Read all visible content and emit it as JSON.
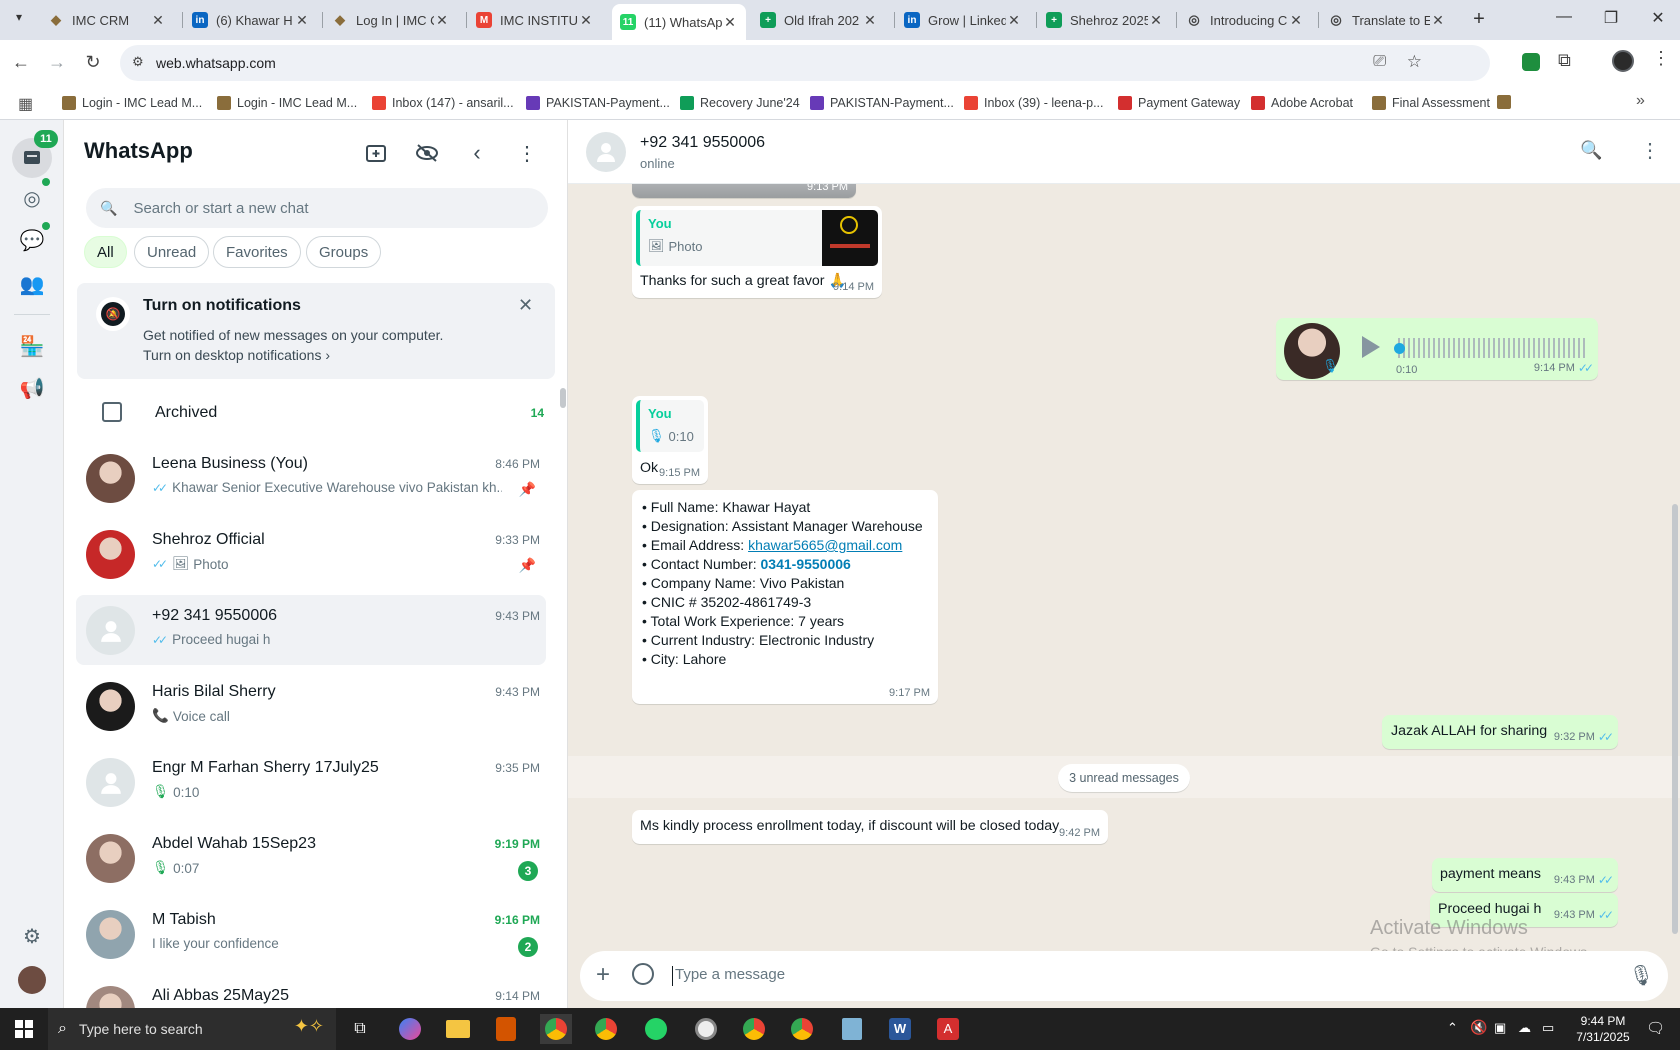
{
  "browser": {
    "tabs": [
      {
        "title": "IMC CRM",
        "color": "#8a6d3b",
        "glyph": "◆"
      },
      {
        "title": "(6) Khawar H",
        "color": "#0a66c2",
        "glyph": "in"
      },
      {
        "title": "Log In | IMC C",
        "color": "#8a6d3b",
        "glyph": "◆"
      },
      {
        "title": "IMC INSTITUT",
        "color": "#ea4335",
        "glyph": "M"
      },
      {
        "title": "(11) WhatsApp",
        "color": "#25d366",
        "glyph": "11",
        "active": true
      },
      {
        "title": "Old Ifrah 202",
        "color": "#0f9d58",
        "glyph": "+"
      },
      {
        "title": "Grow | Linked",
        "color": "#0a66c2",
        "glyph": "in"
      },
      {
        "title": "Shehroz 2025",
        "color": "#0f9d58",
        "glyph": "+"
      },
      {
        "title": "Introducing C",
        "color": "#444444",
        "glyph": "◎"
      },
      {
        "title": "Translate to E",
        "color": "#444444",
        "glyph": "◎"
      }
    ],
    "url": "web.whatsapp.com",
    "bookmarks": [
      {
        "label": "Login - IMC Lead M...",
        "color": "#8a6d3b"
      },
      {
        "label": "Login - IMC Lead M...",
        "color": "#8a6d3b"
      },
      {
        "label": "Inbox (147) - ansaril...",
        "color": "#ea4335"
      },
      {
        "label": "PAKISTAN-Payment...",
        "color": "#673ab7"
      },
      {
        "label": "Recovery June'24",
        "color": "#0f9d58"
      },
      {
        "label": "PAKISTAN-Payment...",
        "color": "#673ab7"
      },
      {
        "label": "Inbox (39) - leena-p...",
        "color": "#ea4335"
      },
      {
        "label": "Payment Gateway",
        "color": "#d32f2f"
      },
      {
        "label": "Adobe Acrobat",
        "color": "#d32f2f"
      },
      {
        "label": "Final Assessment",
        "color": "#8a6d3b"
      }
    ]
  },
  "rail": {
    "chats_badge": "11"
  },
  "sidebar": {
    "title": "WhatsApp",
    "search_placeholder": "Search or start a new chat",
    "filters": [
      "All",
      "Unread",
      "Favorites",
      "Groups"
    ],
    "notification": {
      "title": "Turn on notifications",
      "body": "Get notified of new messages on your computer.",
      "link": "Turn on desktop notifications"
    },
    "archived": {
      "label": "Archived",
      "count": "14"
    },
    "chats": [
      {
        "name": "Leena Business (You)",
        "time": "8:46 PM",
        "preview": "Khawar Senior Executive Warehouse vivo Pakistan kh...",
        "ticks": true,
        "pinned": true,
        "avatar": "#6d4c41"
      },
      {
        "name": "Shehroz Official",
        "time": "9:33 PM",
        "preview": "Photo",
        "ticks": true,
        "photo": true,
        "pinned": true,
        "avatar": "#c62828"
      },
      {
        "name": "+92 341 9550006",
        "time": "9:43 PM",
        "preview": "Proceed hugai h",
        "ticks": true,
        "active": true,
        "placeholder": true
      },
      {
        "name": "Haris Bilal Sherry",
        "time": "9:43 PM",
        "preview": "Voice call",
        "call": true,
        "avatar": "#1b1b1b"
      },
      {
        "name": "Engr M Farhan Sherry 17July25",
        "time": "9:35 PM",
        "preview": "0:10",
        "mic": true,
        "placeholder": true
      },
      {
        "name": "Abdel Wahab 15Sep23",
        "time": "9:19 PM",
        "preview": "0:07",
        "mic": true,
        "unread": "3",
        "avatar": "#8d6e63"
      },
      {
        "name": "M Tabish",
        "time": "9:16 PM",
        "preview": "I like your confidence",
        "unread": "2",
        "avatar": "#90a4ae"
      },
      {
        "name": "Ali Abbas 25May25",
        "time": "9:14 PM",
        "preview": "",
        "avatar": "#a1887f"
      }
    ]
  },
  "conversation": {
    "contact": "+92 341 9550006",
    "status": "online",
    "messages": {
      "m0_time": "9:13 PM",
      "m1": {
        "quote_name": "You",
        "quote_sub": "Photo",
        "text": "Thanks for such a great favor 🙏",
        "time": "9:14 PM"
      },
      "m2": {
        "duration": "0:10",
        "time": "9:14 PM"
      },
      "m3": {
        "quote_name": "You",
        "quote_sub": "0:10",
        "text": "Ok",
        "time": "9:15 PM"
      },
      "m4": {
        "lines": [
          {
            "label": "Full Name: ",
            "value": "Khawar Hayat"
          },
          {
            "label": "Designation: ",
            "value": "Assistant Manager Warehouse"
          },
          {
            "label": "Email Address: ",
            "value": "khawar5665@gmail.com",
            "link": true
          },
          {
            "label": "Contact Number: ",
            "value": "0341-9550006",
            "phone": true
          },
          {
            "label": "Company Name: ",
            "value": "Vivo Pakistan"
          },
          {
            "label": "CNIC # ",
            "value": "35202-4861749-3"
          },
          {
            "label": "Total Work Experience: ",
            "value": "7 years"
          },
          {
            "label": "Current Industry: ",
            "value": "Electronic Industry"
          },
          {
            "label": "City: ",
            "value": "Lahore"
          }
        ],
        "time": "9:17 PM"
      },
      "m5": {
        "text": "Jazak ALLAH for sharing",
        "time": "9:32 PM"
      },
      "unread_divider": "3 unread messages",
      "m6": {
        "text": "Ms kindly process enrollment today, if discount will be closed today",
        "time": "9:42 PM"
      },
      "m7": {
        "text": "payment means",
        "time": "9:43 PM"
      },
      "m8": {
        "text": "Proceed hugai h",
        "time": "9:43 PM"
      }
    },
    "composer_placeholder": "Type a message"
  },
  "watermark": {
    "title": "Activate Windows",
    "sub": "Go to Settings to activate Windows."
  },
  "taskbar": {
    "search_placeholder": "Type here to search",
    "time": "9:44 PM",
    "date": "7/31/2025"
  }
}
